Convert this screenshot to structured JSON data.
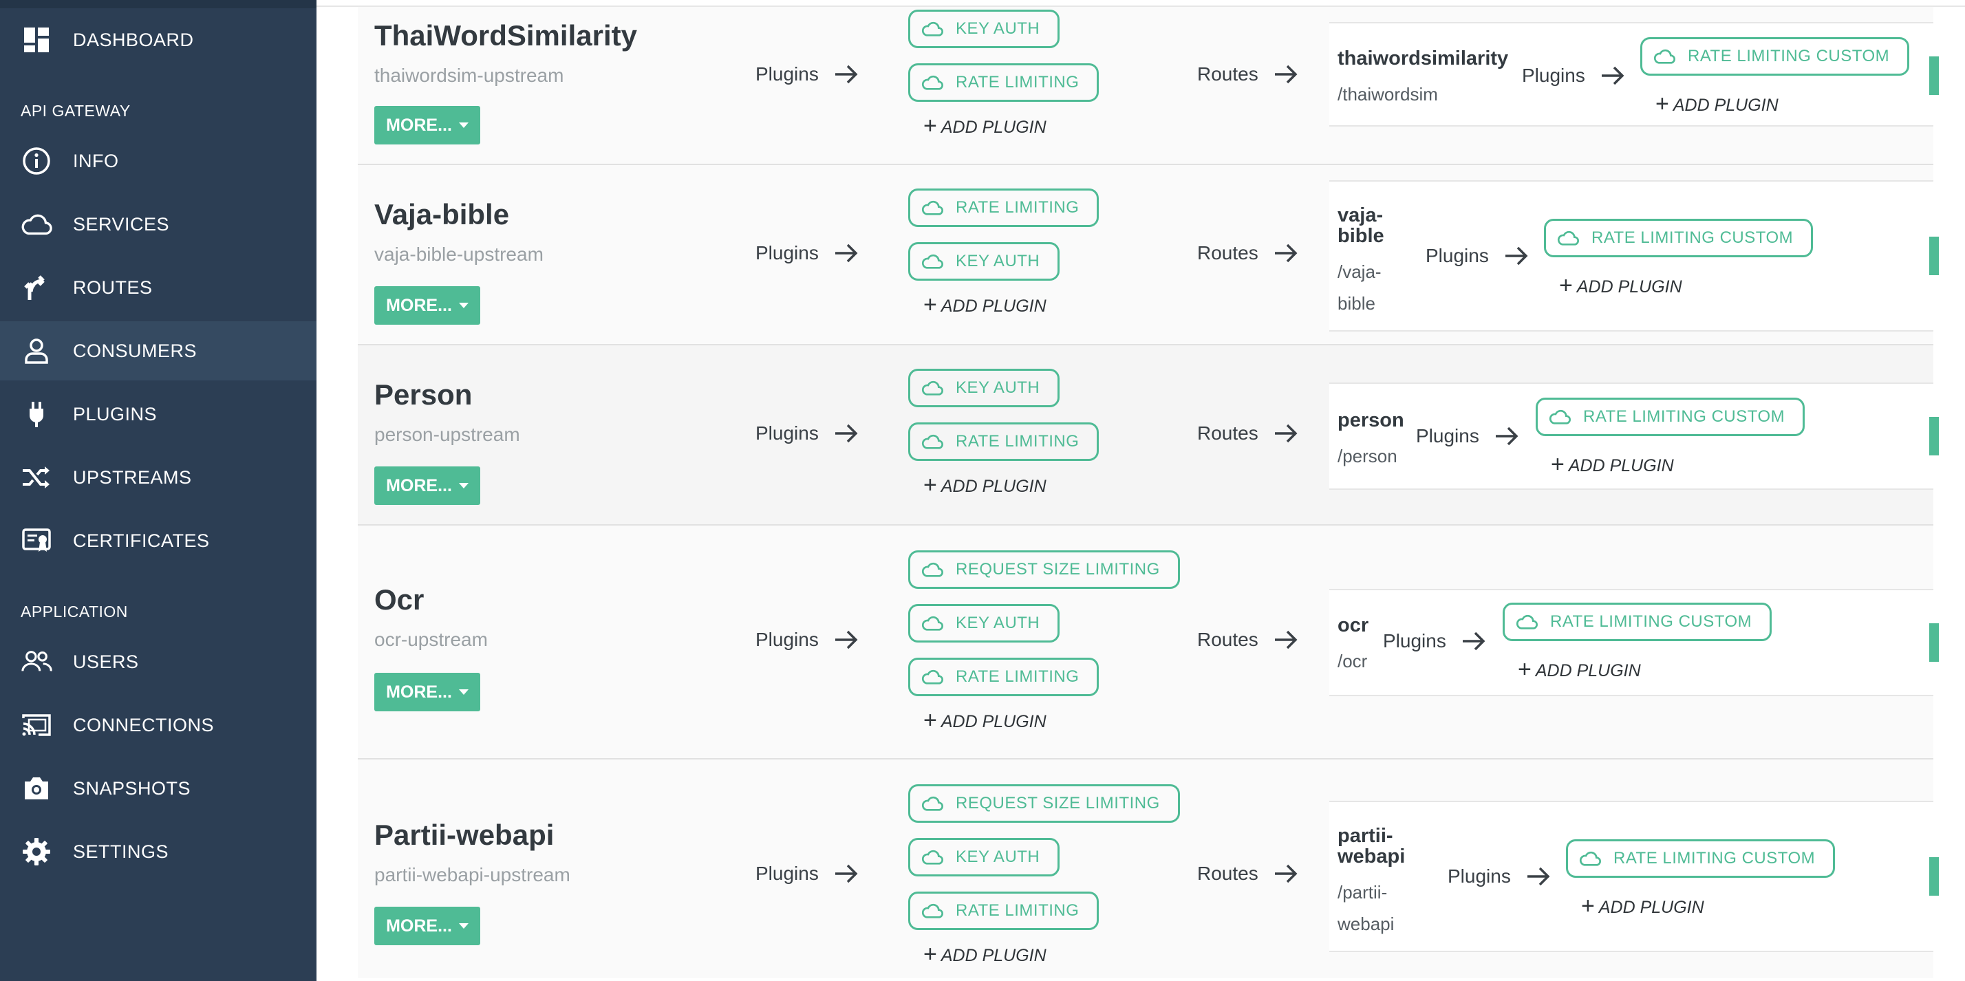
{
  "sidebar": {
    "items": [
      {
        "label": "DASHBOARD",
        "icon": "dashboard-icon"
      },
      {
        "label": "INFO",
        "icon": "info-icon"
      },
      {
        "label": "SERVICES",
        "icon": "cloud-icon"
      },
      {
        "label": "ROUTES",
        "icon": "routes-icon"
      },
      {
        "label": "CONSUMERS",
        "icon": "user-icon"
      },
      {
        "label": "PLUGINS",
        "icon": "plug-icon"
      },
      {
        "label": "UPSTREAMS",
        "icon": "shuffle-icon"
      },
      {
        "label": "CERTIFICATES",
        "icon": "certificate-icon"
      },
      {
        "label": "USERS",
        "icon": "users-icon"
      },
      {
        "label": "CONNECTIONS",
        "icon": "cast-icon"
      },
      {
        "label": "SNAPSHOTS",
        "icon": "camera-icon"
      },
      {
        "label": "SETTINGS",
        "icon": "gear-icon"
      }
    ],
    "sections": {
      "api_gateway": "API GATEWAY",
      "application": "APPLICATION"
    }
  },
  "labels": {
    "plugins": "Plugins",
    "routes": "Routes",
    "more": "MORE...",
    "add_plugin": "ADD PLUGIN"
  },
  "services": [
    {
      "name": "ThaiWordSimilarity",
      "upstream": "thaiwordsim-upstream",
      "plugins": [
        "KEY AUTH",
        "RATE LIMITING"
      ],
      "route": {
        "name": "thaiwordsimilarity",
        "path": "/thaiwordsim",
        "plugins": [
          "RATE LIMITING CUSTOM"
        ]
      }
    },
    {
      "name": "Vaja-bible",
      "upstream": "vaja-bible-upstream",
      "plugins": [
        "RATE LIMITING",
        "KEY AUTH"
      ],
      "route": {
        "name_lines": [
          "vaja-",
          "bible"
        ],
        "path_lines": [
          "/vaja-",
          "bible"
        ],
        "plugins": [
          "RATE LIMITING CUSTOM"
        ]
      }
    },
    {
      "name": "Person",
      "upstream": "person-upstream",
      "plugins": [
        "KEY AUTH",
        "RATE LIMITING"
      ],
      "route": {
        "name": "person",
        "path": "/person",
        "plugins": [
          "RATE LIMITING CUSTOM"
        ]
      }
    },
    {
      "name": "Ocr",
      "upstream": "ocr-upstream",
      "plugins": [
        "REQUEST SIZE LIMITING",
        "KEY AUTH",
        "RATE LIMITING"
      ],
      "route": {
        "name": "ocr",
        "path": "/ocr",
        "plugins": [
          "RATE LIMITING CUSTOM"
        ]
      }
    },
    {
      "name": "Partii-webapi",
      "upstream": "partii-webapi-upstream",
      "plugins": [
        "REQUEST SIZE LIMITING",
        "KEY AUTH",
        "RATE LIMITING"
      ],
      "route": {
        "name_lines": [
          "partii-",
          "webapi"
        ],
        "path_lines": [
          "/partii-",
          "webapi"
        ],
        "plugins": [
          "RATE LIMITING CUSTOM"
        ]
      }
    }
  ],
  "colors": {
    "sidebar_bg": "#2c3e54",
    "accent": "#4fbb95",
    "active_item": "#354a61"
  }
}
